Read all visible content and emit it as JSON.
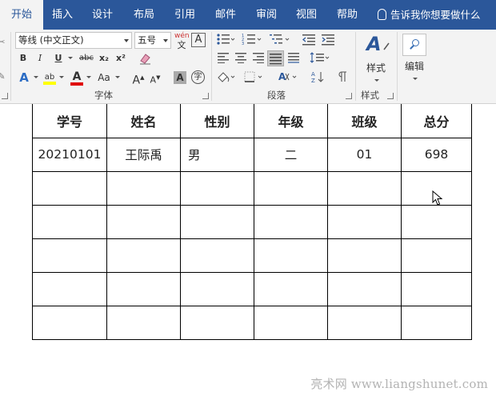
{
  "tabs": [
    {
      "label": "开始",
      "active": true
    },
    {
      "label": "插入",
      "active": false
    },
    {
      "label": "设计",
      "active": false
    },
    {
      "label": "布局",
      "active": false
    },
    {
      "label": "引用",
      "active": false
    },
    {
      "label": "邮件",
      "active": false
    },
    {
      "label": "审阅",
      "active": false
    },
    {
      "label": "视图",
      "active": false
    },
    {
      "label": "帮助",
      "active": false
    }
  ],
  "tell_me": "告诉我你想要做什么",
  "ribbon": {
    "font": {
      "group_label": "字体",
      "font_name": "等线 (中文正文)",
      "font_size": "五号",
      "wen_icon": "wén",
      "char_border_icon": "A",
      "bold": "B",
      "italic": "I",
      "underline": "U",
      "strikethrough": "abc",
      "subscript": "x₂",
      "superscript": "x²",
      "text_effects": "A",
      "highlight": "ab",
      "font_color": "A",
      "change_case": "Aa",
      "grow_font": "A",
      "shrink_font": "A",
      "char_shading": "A",
      "enclose_char": "字"
    },
    "paragraph": {
      "group_label": "段落"
    },
    "styles": {
      "group_label": "样式",
      "button_label": "样式"
    },
    "editing": {
      "button_label": "编辑"
    }
  },
  "table": {
    "headers": [
      "学号",
      "姓名",
      "性别",
      "年级",
      "班级",
      "总分"
    ],
    "rows": [
      [
        "20210101",
        "王际禹",
        "男",
        "二",
        "01",
        "698"
      ],
      [
        "",
        "",
        "",
        "",
        "",
        ""
      ],
      [
        "",
        "",
        "",
        "",
        "",
        ""
      ],
      [
        "",
        "",
        "",
        "",
        "",
        ""
      ],
      [
        "",
        "",
        "",
        "",
        "",
        ""
      ],
      [
        "",
        "",
        "",
        "",
        "",
        ""
      ]
    ]
  },
  "watermark": "亮术网 www.liangshunet.com",
  "colors": {
    "title_bar": "#2b579a",
    "ribbon_bg": "#f3f3f3",
    "highlight_yellow": "#ffff00",
    "font_color_red": "#e00000"
  }
}
